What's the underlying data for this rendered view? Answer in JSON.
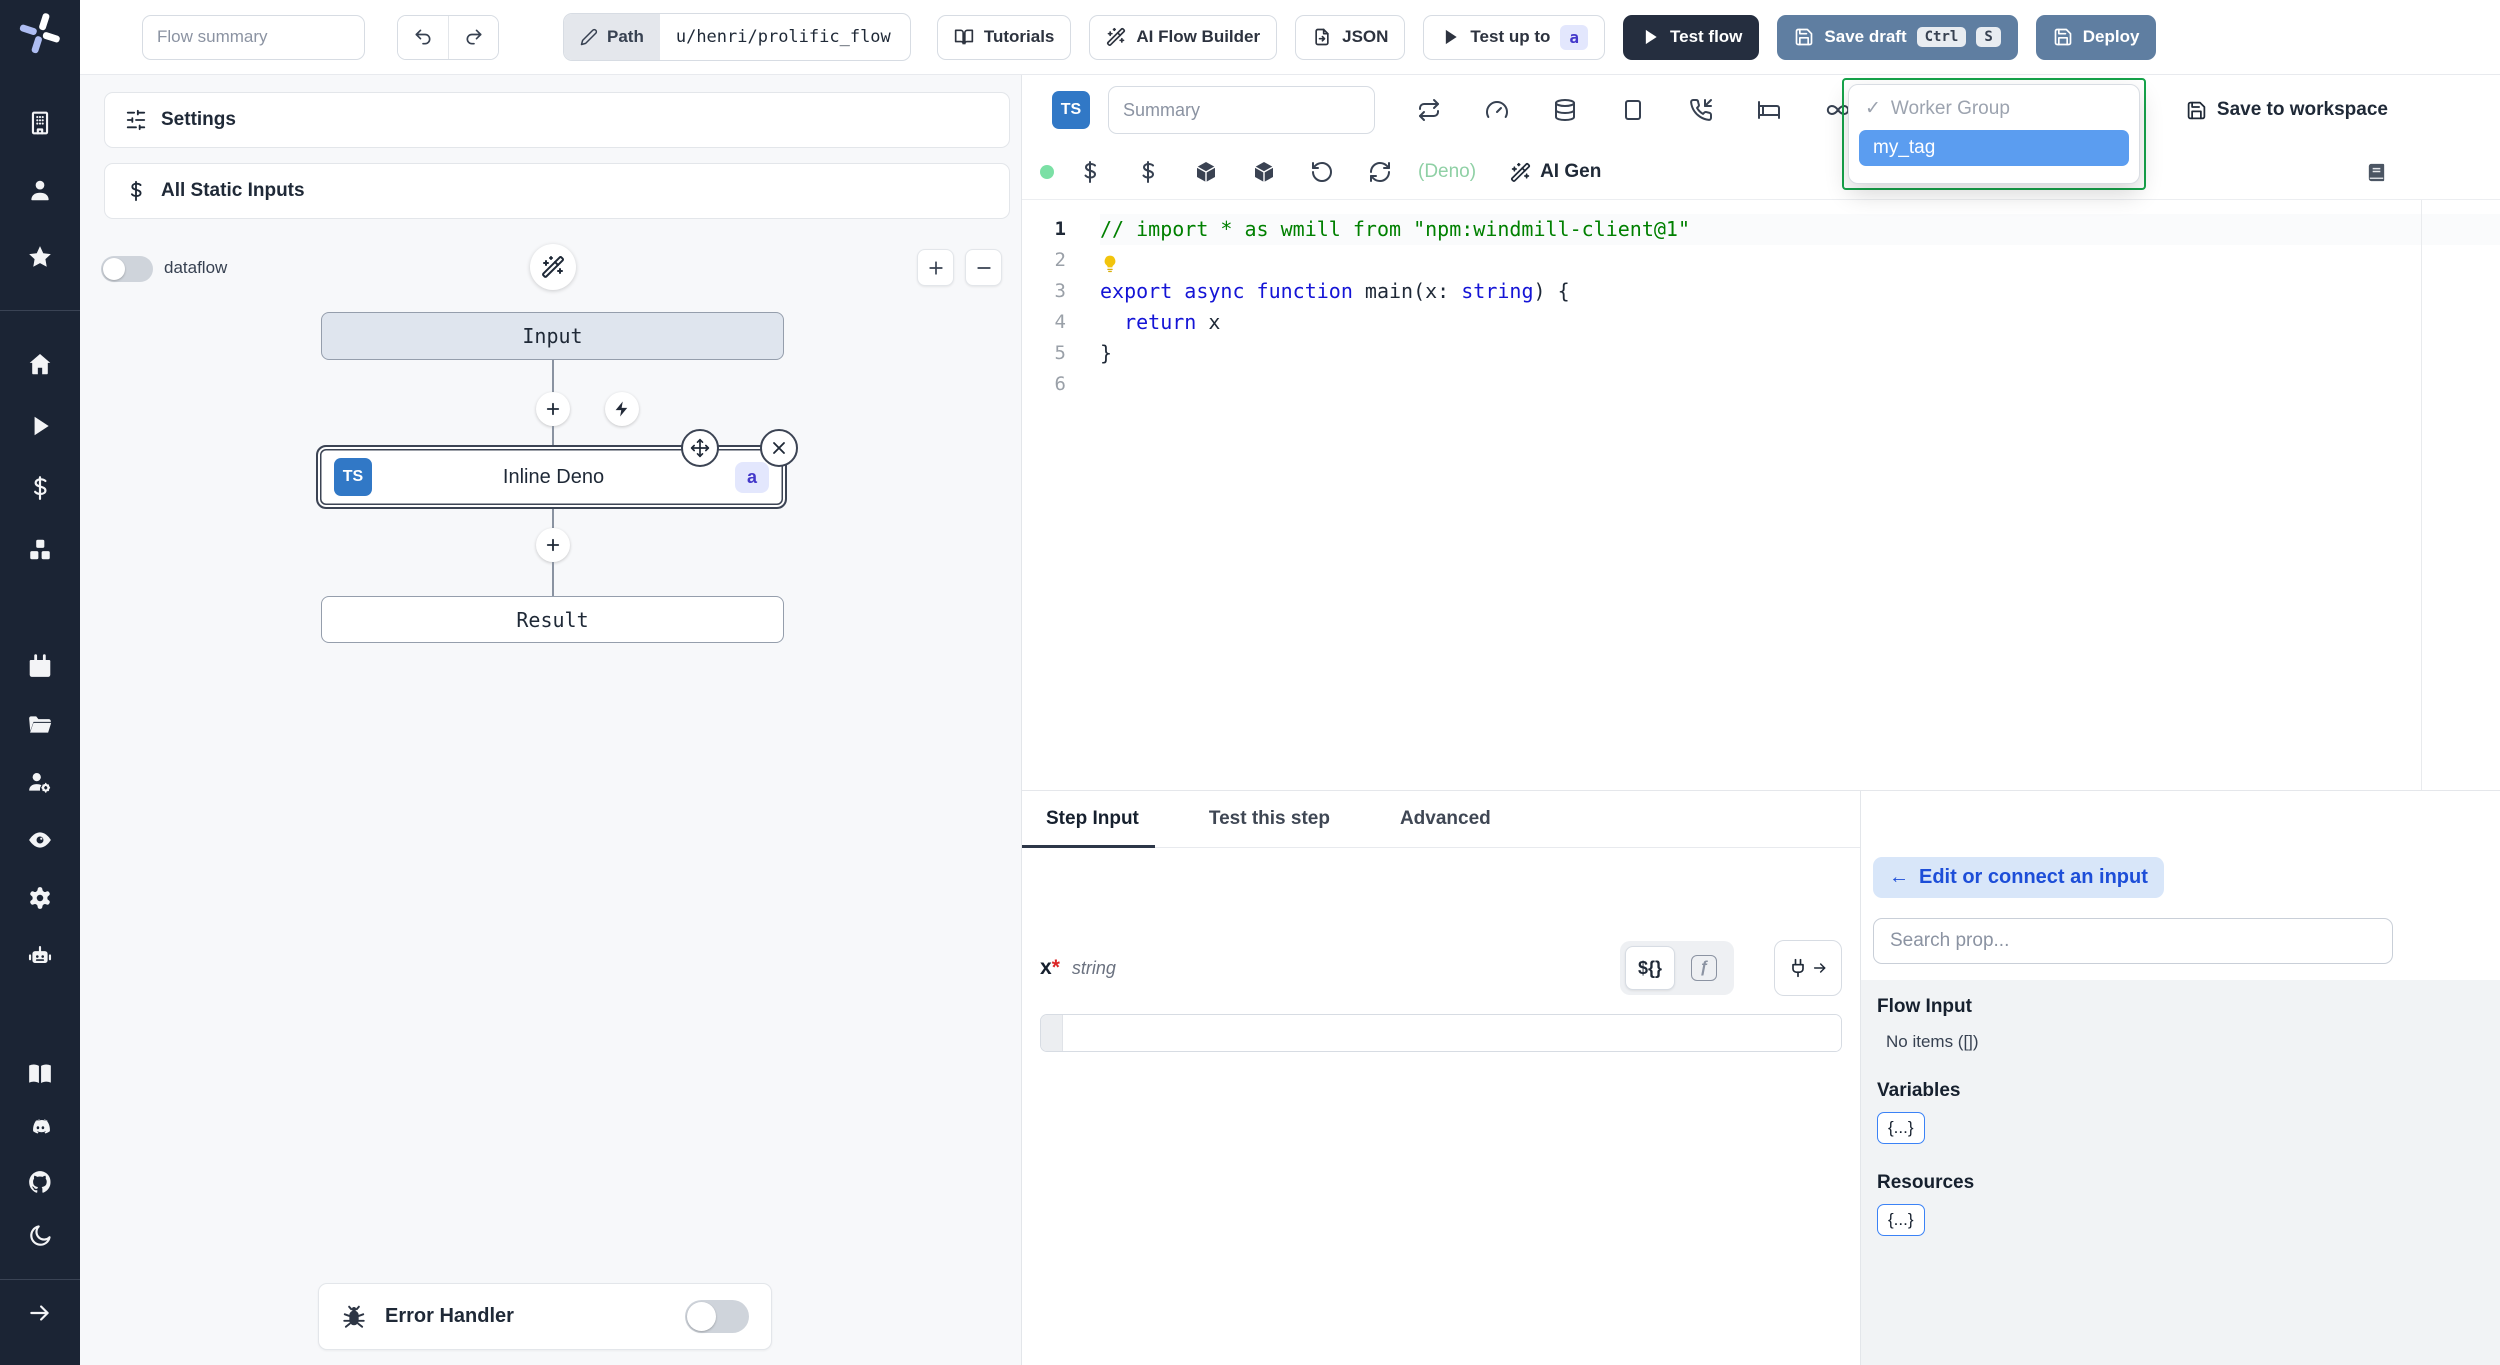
{
  "colors": {
    "sidebar_bg": "#1b2434",
    "ts_badge_blue": "#3178c6",
    "dark_button": "#252e3f",
    "steel_button": "#5f7ea1",
    "dropdown_focus_green": "#16a34a",
    "selected_tag_bg": "#5b9df0",
    "deno_green": "#8fd0a5",
    "status_dot_green": "#7be0a5",
    "badge_indigo_bg": "#e3e7fd",
    "badge_indigo_text": "#4338ca",
    "edit_pill_bg": "#d8e6f9",
    "edit_pill_text": "#1d4ed8",
    "brace_border_blue": "#3b82f6"
  },
  "sidebar": {
    "icons_workspace": [
      "building",
      "user",
      "star"
    ],
    "icons_primary": [
      "home",
      "play",
      "dollar",
      "boxes"
    ],
    "icons_secondary": [
      "calendar",
      "folder",
      "users-cog",
      "eye",
      "settings",
      "bot"
    ],
    "icons_links": [
      "book-open",
      "discord",
      "github",
      "moon"
    ],
    "icons_collapse": [
      "arrow-right"
    ]
  },
  "header": {
    "flow_summary_placeholder": "Flow summary",
    "path_label": "Path",
    "path_value": "u/henri/prolific_flow",
    "tutorials": "Tutorials",
    "ai_flow_builder": "AI Flow Builder",
    "json": "JSON",
    "test_up_to": "Test up to",
    "test_up_to_badge": "a",
    "test_flow": "Test flow",
    "save_draft": "Save draft",
    "save_draft_keys": {
      "k1": "Ctrl",
      "k2": "S"
    },
    "deploy": "Deploy"
  },
  "flow": {
    "settings": "Settings",
    "all_static_inputs": "All Static Inputs",
    "dataflow_label": "dataflow",
    "nodes": {
      "input": "Input",
      "deno_lang": "TS",
      "deno_title": "Inline Deno",
      "deno_badge": "a",
      "result": "Result"
    },
    "error_handler": "Error Handler"
  },
  "editor": {
    "lang_badge": "TS",
    "summary_placeholder": "Summary",
    "toolbar1_icons": [
      "repeat",
      "gauge",
      "database",
      "square",
      "phone-incoming",
      "bed"
    ],
    "toolbar1_right_icons": [
      "infinity"
    ],
    "toolbar2_icons": [
      "dollar",
      "dollar",
      "package",
      "package",
      "rotate-ccw",
      "refresh-cw"
    ],
    "deno_label": "(Deno)",
    "ai_gen": "AI Gen",
    "worker_group": {
      "check": "✓",
      "label": "Worker Group",
      "selected": "my_tag"
    },
    "save_to_workspace": "Save to workspace",
    "code": [
      {
        "tokens": [
          {
            "t": "// import * as wmill from \"npm:windmill-client@1\"",
            "c": "comment"
          }
        ]
      },
      {
        "bulb": true,
        "tokens": []
      },
      {
        "tokens": [
          {
            "t": "export ",
            "c": "kw"
          },
          {
            "t": "async ",
            "c": "kw"
          },
          {
            "t": "function ",
            "c": "kw"
          },
          {
            "t": "main",
            "c": "fn"
          },
          {
            "t": "(x: ",
            "c": "plain"
          },
          {
            "t": "string",
            "c": "kw"
          },
          {
            "t": ") {",
            "c": "plain"
          }
        ]
      },
      {
        "tokens": [
          {
            "t": "  ",
            "c": "plain"
          },
          {
            "t": "return",
            "c": "kw"
          },
          {
            "t": " x",
            "c": "plain"
          }
        ]
      },
      {
        "tokens": [
          {
            "t": "}",
            "c": "plain"
          }
        ]
      },
      {
        "tokens": []
      }
    ]
  },
  "step_panel": {
    "tabs": [
      "Step Input",
      "Test this step",
      "Advanced"
    ],
    "field": {
      "name": "x",
      "required": "*",
      "type": "string"
    },
    "expr_toggle": "${}",
    "fn_toggle": "ƒ"
  },
  "props": {
    "edit_arrow": "←",
    "edit_label": "Edit or connect an input",
    "search_placeholder": "Search prop...",
    "flow_input_title": "Flow Input",
    "flow_input_empty": "No items ([])",
    "variables_title": "Variables",
    "variables_value": "{...}",
    "resources_title": "Resources",
    "resources_value": "{...}"
  }
}
